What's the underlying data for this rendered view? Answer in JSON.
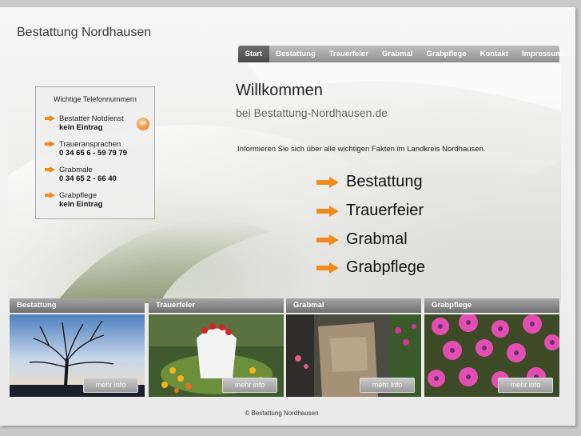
{
  "site": {
    "title": "Bestattung Nordhausen"
  },
  "nav": {
    "items": [
      "Start",
      "Bestattung",
      "Trauerfeier",
      "Grabmal",
      "Grabpflege",
      "Kontakt",
      "Impressum"
    ],
    "active": "Start"
  },
  "phone_box": {
    "title": "Wichtige Telefonnummern",
    "entries": [
      {
        "label": "Bestatter Notdienst",
        "value": "kein Eintrag"
      },
      {
        "label": "Traueransprachen",
        "value": "0 34 65 6 - 59 79 79"
      },
      {
        "label": "Grabmale",
        "value": "0 34 65 2 - 66 40"
      },
      {
        "label": "Grabpflege",
        "value": "kein Eintrag"
      }
    ],
    "badge": "24"
  },
  "main": {
    "heading": "Willkommen",
    "subheading": "bei Bestattung-Nordhausen.de",
    "intro": "Informieren Sie sich über alle wichtigen Fakten im Landkreis Nordhausen.",
    "links": [
      "Bestattung",
      "Trauerfeier",
      "Grabmal",
      "Grabpflege"
    ]
  },
  "cards": [
    {
      "title": "Bestattung",
      "button": "mehr info"
    },
    {
      "title": "Trauerfeier",
      "button": "mehr info"
    },
    {
      "title": "Grabmal",
      "button": "mehr info"
    },
    {
      "title": "Grabpflege",
      "button": "mehr info"
    }
  ],
  "footer": {
    "text": "© Bestattung Nordhausen"
  },
  "colors": {
    "accent": "#f08a1c",
    "nav_dark": "#555555",
    "nav_light": "#a8a8a8"
  }
}
